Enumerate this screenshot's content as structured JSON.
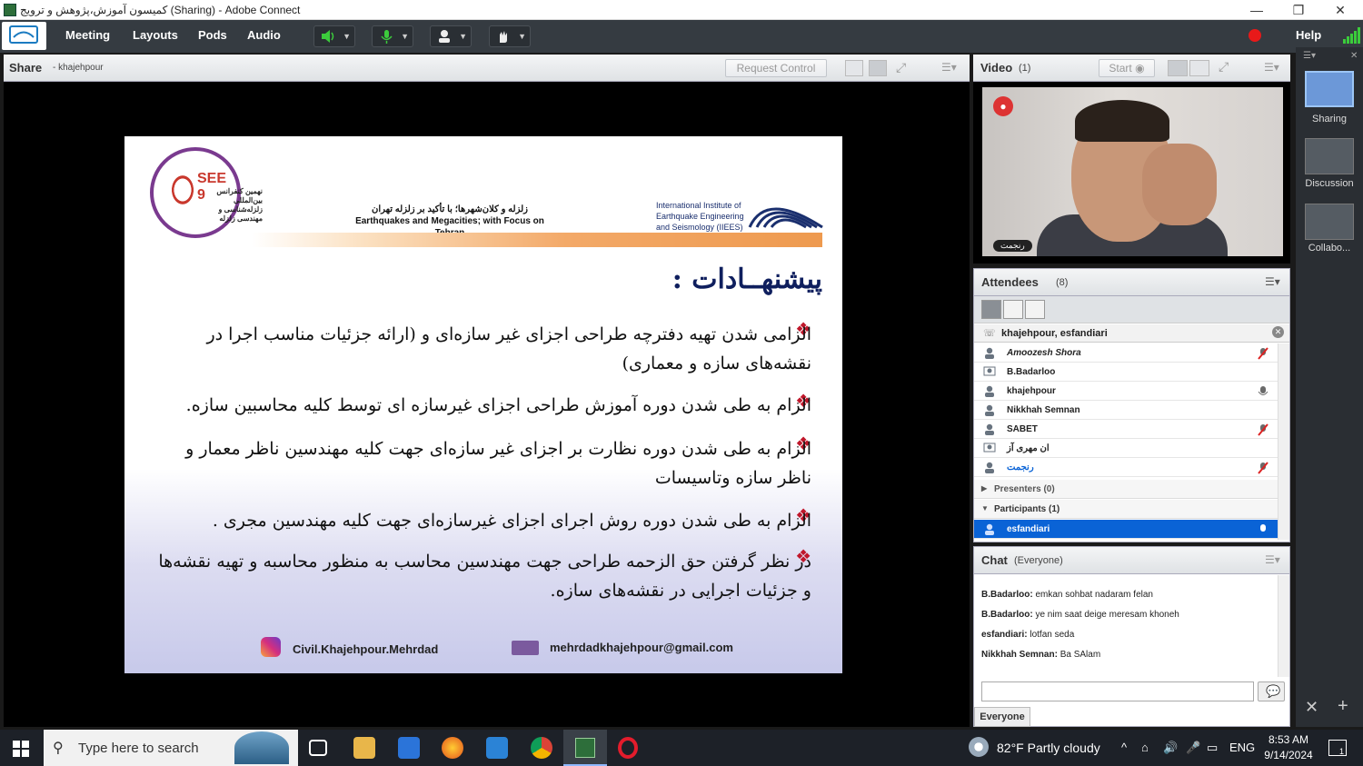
{
  "window": {
    "title": "كميسون آموزش،پژوهش و ترويج (Sharing) - Adobe Connect",
    "controls": [
      "—",
      "❐",
      "✕"
    ]
  },
  "menubar": {
    "items": [
      "Meeting",
      "Layouts",
      "Pods",
      "Audio"
    ],
    "help_label": "Help"
  },
  "share_pod": {
    "title": "Share",
    "presenter": "- khajehpour",
    "request_control_label": "Request Control"
  },
  "slide": {
    "conference_name": "SEE 9",
    "conference_fa": "نهمین کنفرانس بین‌المللی زلزله‌شناسی و مهندسی زلزله",
    "subtitle_fa": "زلزله و کلان‌شهرها؛ با تأکید بر زلزله تهران",
    "subtitle_en": "Earthquakes and Megacities; with Focus on Tehran",
    "institute_en": [
      "International Institute of",
      "Earthquake Engineering",
      "and Seismology (IIEES)"
    ],
    "heading": "پیشنهــادات :",
    "items": [
      "الزامی شدن تهیه دفترچه طراحی اجزای غیر سازه‌ای و (ارائه جزئیات مناسب اجرا در نقشه‌های سازه و معماری)",
      "الزام به طی شدن دوره آموزش طراحی اجزای غیرسازه ای توسط کلیه محاسبین سازه.",
      "الزام به طی شدن دوره نظارت بر اجزای غیر سازه‌ای جهت کلیه مهندسین ناظر معمار و ناظر سازه وتاسیسات",
      "الزام به طی شدن دوره روش اجرای اجزای غیرسازه‌ای جهت کلیه مهندسین مجری .",
      "در نظر گرفتن حق الزحمه طراحی جهت مهندسین محاسب به منظور محاسبه و تهیه نقشه‌ها و جزئیات اجرایی در نقشه‌های سازه."
    ],
    "instagram": "Civil.Khajehpour.Mehrdad",
    "email": "mehrdadkhajehpour@gmail.com"
  },
  "video_pod": {
    "title": "Video",
    "count": "(1)",
    "start_label": "Start",
    "cam_name": "رنجمت"
  },
  "attendees_pod": {
    "title": "Attendees",
    "count": "(8)",
    "filter": "khajehpour, esfandiari",
    "attendees": [
      {
        "name": "Amoozesh Shora",
        "italic": true
      },
      {
        "name": "B.Badarloo"
      },
      {
        "name": "khajehpour"
      },
      {
        "name": "Nikkhah Semnan"
      },
      {
        "name": "SABET"
      },
      {
        "name": "ان مهری آز"
      },
      {
        "name": "رنجمت"
      }
    ],
    "presenters_group": "Presenters (0)",
    "participants_group": "Participants (1)",
    "selected_participant": "esfandiari"
  },
  "chat_pod": {
    "title": "Chat",
    "scope": "(Everyone)",
    "messages": [
      {
        "sender": "B.Badarloo:",
        "text": "emkan sohbat nadaram felan"
      },
      {
        "sender": "B.Badarloo:",
        "text": "ye nim saat deige meresam khoneh"
      },
      {
        "sender": "esfandiari:",
        "text": "lotfan seda"
      },
      {
        "sender": "Nikkhah Semnan:",
        "text": "Ba SAlam"
      }
    ],
    "tab_label": "Everyone"
  },
  "layouts": {
    "items": [
      "Sharing",
      "Discussion",
      "Collabo..."
    ]
  },
  "taskbar": {
    "search_placeholder": "Type here to search",
    "weather": "82°F  Partly cloudy",
    "lang": "ENG",
    "time": "8:53 AM",
    "date": "9/14/2024",
    "notification_count": "1"
  },
  "colors": {
    "menubar_bg": "#353b41",
    "accent_blue": "#0a63d6",
    "record_red": "#e81919",
    "slide_heading": "#0f1f5e"
  }
}
